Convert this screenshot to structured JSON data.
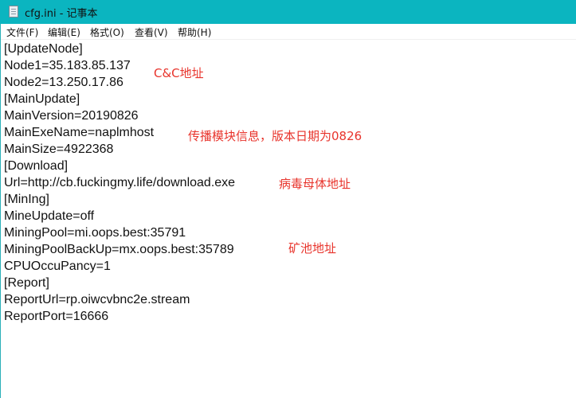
{
  "window": {
    "title": "cfg.ini - 记事本",
    "icon": "notepad-icon",
    "accent": "#0bb5c0"
  },
  "menu": [
    {
      "label": "文件(F)"
    },
    {
      "label": "编辑(E)"
    },
    {
      "label": "格式(O)"
    },
    {
      "label": "查看(V)"
    },
    {
      "label": "帮助(H)"
    }
  ],
  "lines": [
    "[UpdateNode]",
    "Node1=35.183.85.137",
    "Node2=13.250.17.86",
    "[MainUpdate]",
    "MainVersion=20190826",
    "MainExeName=naplmhost",
    "MainSize=4922368",
    "[Download]",
    "Url=http://cb.fuckingmy.life/download.exe",
    "[MinIng]",
    "MineUpdate=off",
    "MiningPool=mi.oops.best:35791",
    "MiningPoolBackUp=mx.oops.best:35789",
    "CPUOccuPancy=1",
    "[Report]",
    "ReportUrl=rp.oiwcvbnc2e.stream",
    "ReportPort=16666"
  ],
  "annotations": {
    "cc": "C&C地址",
    "spread": "传播模块信息，版本日期为0826",
    "payload": "病毒母体地址",
    "pool": "矿池地址",
    "color": "#e8342c"
  }
}
